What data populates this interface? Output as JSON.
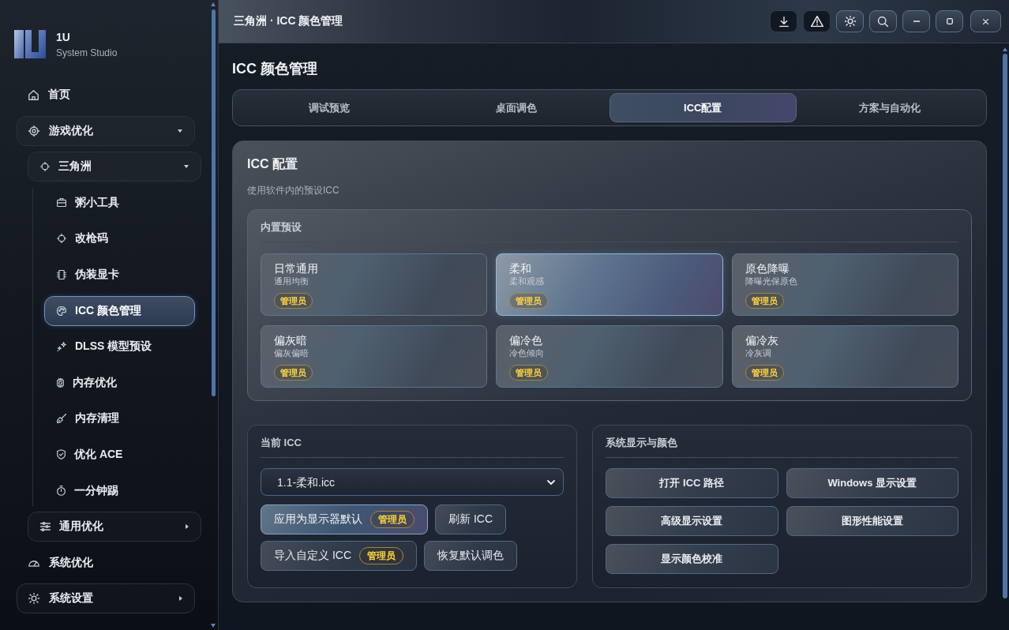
{
  "sidebar": {
    "app_name": "1U",
    "app_tagline": "System Studio",
    "items": [
      {
        "label": "首页",
        "kind": "link",
        "selected": false
      },
      {
        "label": "游戏优化",
        "kind": "group",
        "expanded": true,
        "selected": false,
        "children": [
          {
            "label": "三角洲",
            "kind": "group",
            "expanded": true,
            "selected": false,
            "children": [
              {
                "label": "粥小工具",
                "kind": "link",
                "selected": false
              },
              {
                "label": "改枪码",
                "kind": "link",
                "selected": false
              },
              {
                "label": "伪装显卡",
                "kind": "link",
                "selected": false
              },
              {
                "label": "ICC 颜色管理",
                "kind": "link",
                "selected": true
              },
              {
                "label": "DLSS 模型预设",
                "kind": "link",
                "selected": false
              },
              {
                "label": "内存优化",
                "kind": "link",
                "selected": false
              },
              {
                "label": "内存清理",
                "kind": "link",
                "selected": false
              },
              {
                "label": "优化 ACE",
                "kind": "link",
                "selected": false
              },
              {
                "label": "一分钟踢",
                "kind": "link",
                "selected": false
              }
            ]
          },
          {
            "label": "通用优化",
            "kind": "group",
            "expanded": false,
            "selected": false
          }
        ]
      },
      {
        "label": "系统优化",
        "kind": "link",
        "selected": false
      },
      {
        "label": "系统设置",
        "kind": "group",
        "expanded": false,
        "selected": false
      }
    ]
  },
  "title_bar": {
    "title": "三角洲 · ICC 颜色管理"
  },
  "page_title": "ICC 颜色管理",
  "tabs": [
    {
      "label": "调试预览",
      "selected": false
    },
    {
      "label": "桌面调色",
      "selected": false
    },
    {
      "label": "ICC配置",
      "selected": true
    },
    {
      "label": "方案与自动化",
      "selected": false
    }
  ],
  "icc_config": {
    "title": "ICC 配置",
    "description": "使用软件内的预设ICC",
    "builtin_presets": {
      "title": "内置预设",
      "presets": [
        {
          "name": "日常通用",
          "description": "通用均衡",
          "badge": "管理员",
          "selected": false
        },
        {
          "name": "柔和",
          "description": "柔和观感",
          "badge": "管理员",
          "selected": true
        },
        {
          "name": "原色降曝",
          "description": "降曝光保原色",
          "badge": "管理员",
          "selected": false
        },
        {
          "name": "偏灰暗",
          "description": "偏灰偏暗",
          "badge": "管理员",
          "selected": false
        },
        {
          "name": "偏冷色",
          "description": "冷色倾向",
          "badge": "管理员",
          "selected": false
        },
        {
          "name": "偏冷灰",
          "description": "冷灰调",
          "badge": "管理员",
          "selected": false
        }
      ]
    },
    "current_icc": {
      "title": "当前 ICC",
      "select": {
        "value": "1.1-柔和.icc"
      },
      "buttons": [
        {
          "label": "应用为显示器默认",
          "badge": "管理员",
          "kind": "primary"
        },
        {
          "label": "刷新 ICC",
          "kind": "default"
        },
        {
          "label": "导入自定义 ICC",
          "badge": "管理员",
          "kind": "default"
        },
        {
          "label": "恢复默认调色",
          "kind": "default"
        }
      ]
    },
    "system_display": {
      "title": "系统显示与颜色",
      "buttons": [
        "打开 ICC 路径",
        "Windows 显示设置",
        "高级显示设置",
        "图形性能设置",
        "显示颜色校准"
      ]
    }
  }
}
